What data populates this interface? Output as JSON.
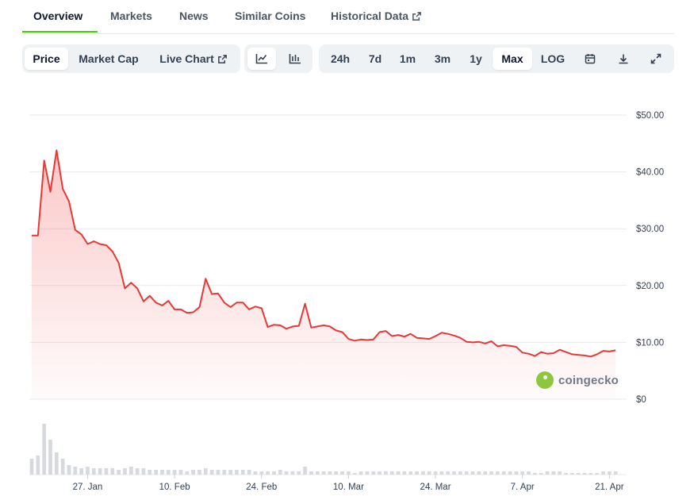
{
  "tabs": [
    {
      "label": "Overview"
    },
    {
      "label": "Markets"
    },
    {
      "label": "News"
    },
    {
      "label": "Similar Coins"
    },
    {
      "label": "Historical Data"
    }
  ],
  "controls": {
    "metrics": [
      "Price",
      "Market Cap",
      "Live Chart"
    ],
    "active_metric": "Price",
    "chart_styles": [
      "line-chart-icon",
      "candlestick-icon"
    ],
    "ranges": [
      "24h",
      "7d",
      "1m",
      "3m",
      "1y",
      "Max",
      "LOG"
    ],
    "active_range": "Max",
    "tool_icons": [
      "calendar-icon",
      "download-icon",
      "fullscreen-icon"
    ]
  },
  "watermark": "coingecko",
  "colors": {
    "line": "#e53935",
    "accent": "#4bcc00",
    "volume": "#d6d9dd"
  },
  "chart_data": {
    "type": "area",
    "y_ticks": [
      "$50.00",
      "$40.00",
      "$30.00",
      "$20.00",
      "$10.00",
      "$0"
    ],
    "y_tick_values": [
      50,
      40,
      30,
      20,
      10,
      0
    ],
    "ylim": [
      0,
      50
    ],
    "x_ticks": [
      "27. Jan",
      "10. Feb",
      "24. Feb",
      "10. Mar",
      "24. Mar",
      "7. Apr",
      "21. Apr"
    ],
    "x_tick_days": [
      9,
      23,
      37,
      51,
      65,
      79,
      93
    ],
    "xlim": [
      0,
      95
    ],
    "series": [
      {
        "values": [
          [
            0,
            28.8
          ],
          [
            1,
            28.8
          ],
          [
            2,
            42
          ],
          [
            3,
            36.5
          ],
          [
            4,
            43.8
          ],
          [
            5,
            37
          ],
          [
            6,
            34.8
          ],
          [
            7,
            29.8
          ],
          [
            8,
            29
          ],
          [
            9,
            27.3
          ],
          [
            10,
            27.8
          ],
          [
            11,
            27.3
          ],
          [
            12,
            27.1
          ],
          [
            13,
            26
          ],
          [
            14,
            24
          ],
          [
            15,
            19.5
          ],
          [
            16,
            20.5
          ],
          [
            17,
            19.5
          ],
          [
            18,
            17.2
          ],
          [
            19,
            18.2
          ],
          [
            20,
            17
          ],
          [
            21,
            16.5
          ],
          [
            22,
            17.3
          ],
          [
            23,
            15.8
          ],
          [
            24,
            15.8
          ],
          [
            25,
            15.2
          ],
          [
            26,
            15.3
          ],
          [
            27,
            16.2
          ],
          [
            28,
            21.2
          ],
          [
            29,
            18.5
          ],
          [
            30,
            18.6
          ],
          [
            31,
            17
          ],
          [
            32,
            16.2
          ],
          [
            33,
            17
          ],
          [
            34,
            17
          ],
          [
            35,
            15.8
          ],
          [
            36,
            16.3
          ],
          [
            37,
            16
          ],
          [
            38,
            12.7
          ],
          [
            39,
            13.1
          ],
          [
            40,
            13
          ],
          [
            41,
            12.4
          ],
          [
            42,
            12.8
          ],
          [
            43,
            12.9
          ],
          [
            44,
            16.8
          ],
          [
            45,
            12.6
          ],
          [
            46,
            12.8
          ],
          [
            47,
            13
          ],
          [
            48,
            12.8
          ],
          [
            49,
            12.1
          ],
          [
            50,
            11.8
          ],
          [
            51,
            10.6
          ],
          [
            52,
            10.3
          ],
          [
            53,
            10.5
          ],
          [
            54,
            10.4
          ],
          [
            55,
            10.5
          ],
          [
            56,
            11.8
          ],
          [
            57,
            12
          ],
          [
            58,
            11.1
          ],
          [
            59,
            11.3
          ],
          [
            60,
            11
          ],
          [
            61,
            11.5
          ],
          [
            62,
            10.8
          ],
          [
            63,
            10.7
          ],
          [
            64,
            10.6
          ],
          [
            65,
            11.1
          ],
          [
            66,
            11.7
          ],
          [
            67,
            11.5
          ],
          [
            68,
            11.2
          ],
          [
            69,
            10.8
          ],
          [
            70,
            10.1
          ],
          [
            71,
            10
          ],
          [
            72,
            10.1
          ],
          [
            73,
            9.8
          ],
          [
            74,
            10.2
          ],
          [
            75,
            9.3
          ],
          [
            76,
            9.5
          ],
          [
            77,
            9.4
          ],
          [
            78,
            9.2
          ],
          [
            79,
            8.2
          ],
          [
            80,
            8
          ],
          [
            81,
            7.6
          ],
          [
            82,
            8.3
          ],
          [
            83,
            8
          ],
          [
            84,
            8.1
          ],
          [
            85,
            8.7
          ],
          [
            86,
            8.3
          ],
          [
            87,
            7.9
          ],
          [
            88,
            7.8
          ],
          [
            89,
            7.7
          ],
          [
            90,
            7.5
          ],
          [
            91,
            7.9
          ],
          [
            92,
            8.5
          ],
          [
            93,
            8.4
          ],
          [
            94,
            8.6
          ]
        ]
      }
    ],
    "volume": [
      10,
      12,
      32,
      22,
      14,
      10,
      6,
      5,
      4,
      5,
      4,
      4,
      4,
      4,
      3,
      4,
      5,
      4,
      4,
      3,
      3,
      3,
      3,
      3,
      3,
      2,
      3,
      3,
      4,
      3,
      3,
      3,
      3,
      3,
      3,
      3,
      2,
      2,
      2,
      2,
      3,
      2,
      2,
      2,
      5,
      2,
      2,
      2,
      2,
      2,
      2,
      2,
      1,
      2,
      2,
      2,
      2,
      2,
      2,
      2,
      2,
      2,
      2,
      2,
      2,
      2,
      2,
      2,
      2,
      2,
      2,
      2,
      2,
      2,
      2,
      2,
      2,
      2,
      2,
      2,
      2,
      1,
      1,
      2,
      2,
      2,
      1,
      1,
      1,
      1,
      1,
      1,
      2,
      2,
      2
    ],
    "grid": true,
    "legend": "none"
  }
}
